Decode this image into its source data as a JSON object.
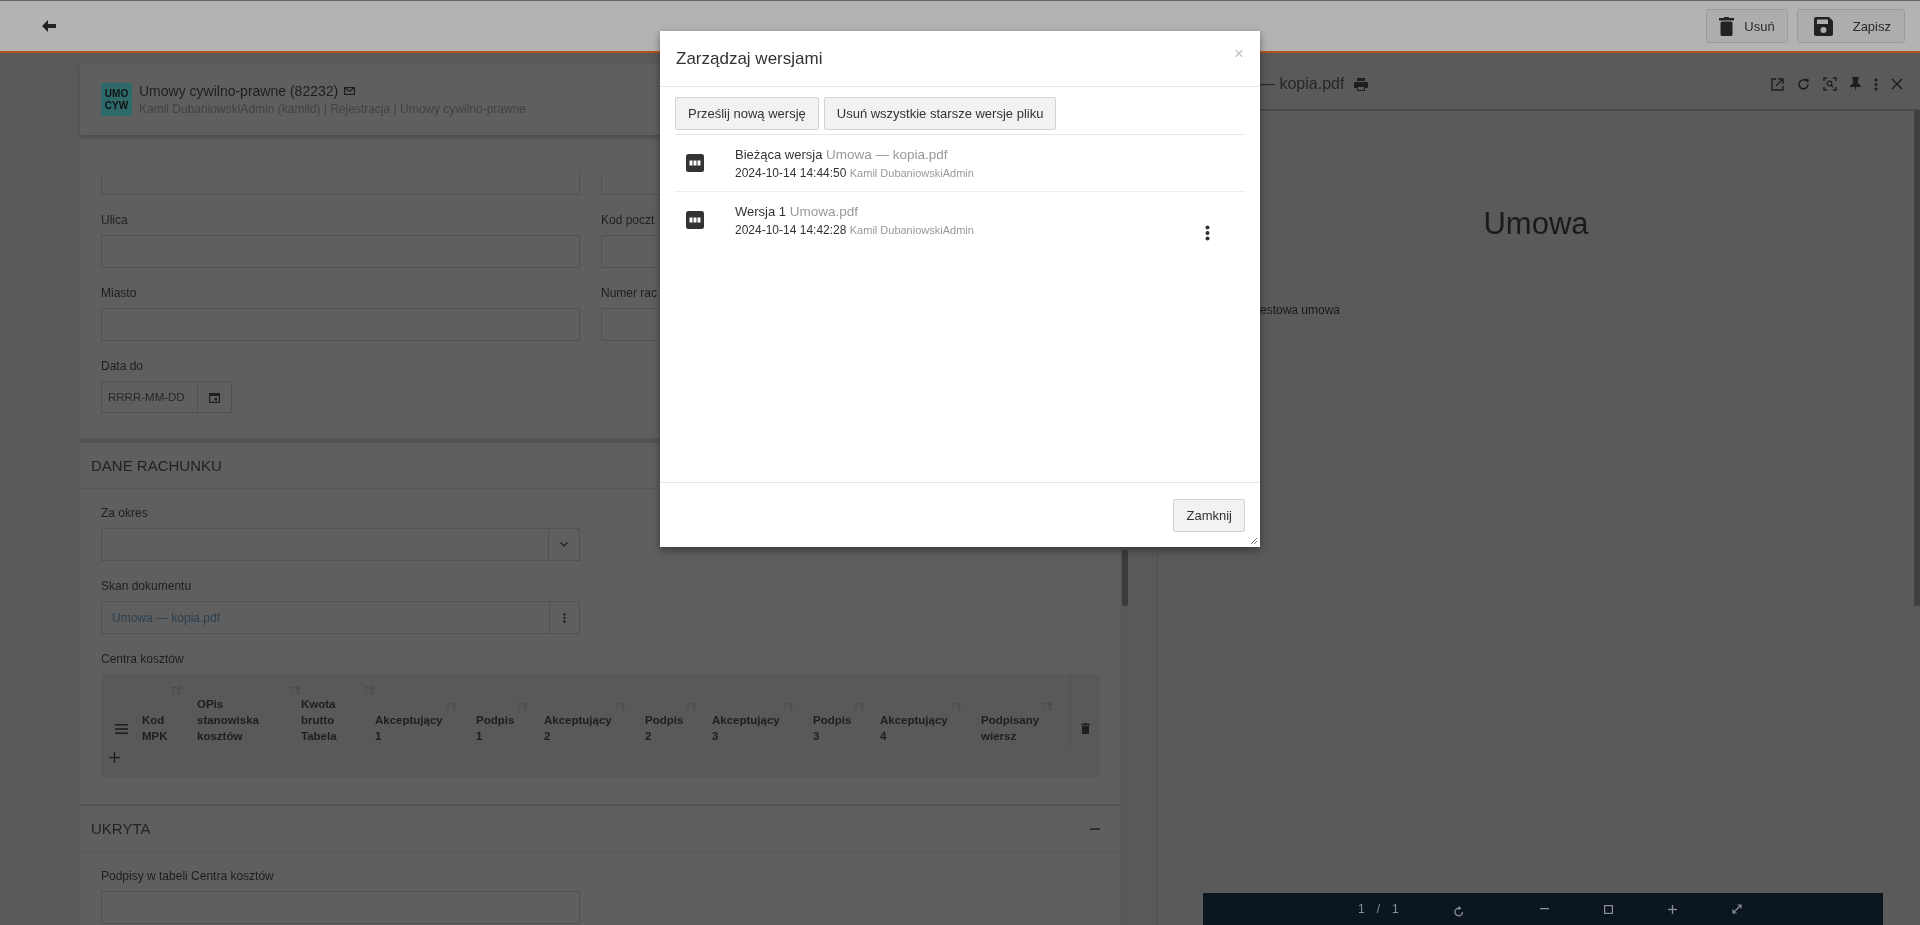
{
  "top_bar": {
    "buttons": [
      {
        "kind": "delete",
        "label": "Usuń"
      },
      {
        "kind": "save",
        "label": "Zapisz"
      }
    ]
  },
  "record": {
    "badge_lines": [
      "UMO",
      "CYW"
    ],
    "title": "Umowy cywilno-prawne (82232)",
    "breadcrumb": "Kamil DubaniowskiAdmin (kamild) | Rejestracja | Umowy cywilno-prawne"
  },
  "address_fields": [
    {
      "label": "Ulica"
    },
    {
      "label": "Kod poczt"
    },
    {
      "label": "Miasto"
    },
    {
      "label": "Numer rac"
    }
  ],
  "date_field": {
    "label": "Data do",
    "placeholder": "RRRR-MM-DD"
  },
  "billing_section": {
    "title": "DANE RACHUNKU",
    "period_label": "Za okres",
    "scan_label": "Skan dokumentu",
    "scan_file": "Umowa — kopia.pdf",
    "cost_centers_label": "Centra kosztów",
    "columns": [
      "Kod\nMPK",
      "OPis\nstanowiska\nkosztów",
      "Kwota\nbrutto\nTabela",
      "Akceptujący\n1",
      "Podpis\n1",
      "Akceptujący\n2",
      "Podpis\n2",
      "Akceptujący\n3",
      "Podpis\n3",
      "Akceptujący\n4",
      "Podpisany\nwiersz"
    ]
  },
  "hidden_section": {
    "title": "UKRYTA",
    "expanded": true,
    "field_label": "Podpisy w tabeli Centra kosztów"
  },
  "viewer": {
    "title": "— kopia.pdf",
    "heading": "Umowa",
    "body_text": "estowa umowa",
    "page": "1",
    "page_separator": "/",
    "pages": "1"
  },
  "modal": {
    "title": "Zarządzaj wersjami",
    "close": "×",
    "actions": [
      "Prześlij nową wersję",
      "Usuń wszystkie starsze wersje pliku"
    ],
    "versions": [
      {
        "label": "Bieżąca wersja",
        "file": "Umowa — kopia.pdf",
        "date": "2024-10-14 14:44:50",
        "author": "Kamil DubaniowskiAdmin",
        "has_menu": false
      },
      {
        "label": "Wersja 1",
        "file": "Umowa.pdf",
        "date": "2024-10-14 14:42:28",
        "author": "Kamil DubaniowskiAdmin",
        "has_menu": true
      }
    ],
    "footer_button": "Zamknij"
  }
}
